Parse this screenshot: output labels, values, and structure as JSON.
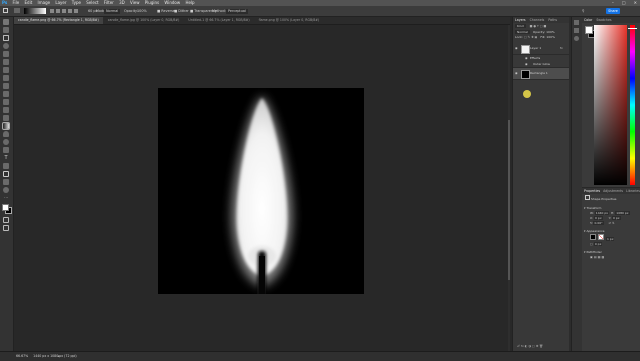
{
  "menubar": {
    "items": [
      "File",
      "Edit",
      "Image",
      "Layer",
      "Type",
      "Select",
      "Filter",
      "3D",
      "View",
      "Plugins",
      "Window",
      "Help"
    ]
  },
  "optionsbar": {
    "size_label": "60 px",
    "mode_label": "Mode:",
    "mode_value": "Normal",
    "opacity_label": "Opacity:",
    "opacity_value": "100%",
    "reverse_label": "Reverse",
    "dither_label": "Dither",
    "transparency_label": "Transparency",
    "method_label": "Method:",
    "method_value": "Perceptual",
    "share_label": "Share"
  },
  "tabs": [
    {
      "label": "candle_flame.png @ 66.7% (Rectangle 1, RGB/8#)",
      "active": true
    },
    {
      "label": "candle_flame.jpg @ 100% (Layer 0, RGB/8#)",
      "active": false
    },
    {
      "label": "Untitled-1 @ 66.7% (Layer 1, RGB/8#)",
      "active": false
    },
    {
      "label": "flame.png @ 100% (Layer 0, RGB/8#)",
      "active": false
    }
  ],
  "layers_panel": {
    "tabs": [
      "Layers",
      "Channels",
      "Paths"
    ],
    "kind_label": "Kind",
    "mode_value": "Normal",
    "opacity_label": "Opacity:",
    "opacity_value": "100%",
    "lock_label": "Lock:",
    "fill_label": "Fill:",
    "fill_value": "100%",
    "layers": [
      {
        "name": "Layer 1",
        "type": "layer"
      },
      {
        "name": "Effects",
        "type": "sub"
      },
      {
        "name": "Outer Glow",
        "type": "sub"
      },
      {
        "name": "Rectangle 1",
        "type": "shape"
      }
    ]
  },
  "color_panel": {
    "tabs": [
      "Color",
      "Swatches"
    ],
    "fg_color": "#ffffff",
    "bg_color": "#000000"
  },
  "properties_panel": {
    "tabs": [
      "Properties",
      "Adjustments",
      "Libraries"
    ],
    "title": "Shape Properties",
    "transform_label": "Transform",
    "w_label": "W:",
    "w_value": "1440 px",
    "h_label": "H:",
    "h_value": "1080 px",
    "x_label": "X:",
    "x_value": "0 px",
    "y_label": "Y:",
    "y_value": "0 px",
    "angle_value": "0.00°",
    "appearance_label": "Appearance",
    "stroke_value": "1 px",
    "radius_value": "0 px",
    "pathfinder_label": "Pathfinder"
  },
  "statusbar": {
    "zoom": "66.67%",
    "doc_info": "1440 px x 1080 px (72 ppi)"
  }
}
